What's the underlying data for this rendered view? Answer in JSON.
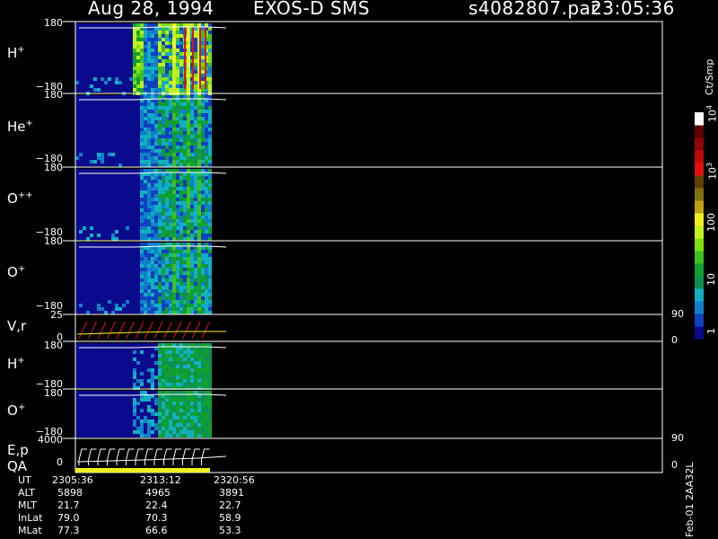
{
  "header": {
    "date": "Aug 28, 1994",
    "mission": "EXOS-D SMS",
    "file": "s4082807.par",
    "time": "23:05:36"
  },
  "colorbar": {
    "unit": "Ct/Smp",
    "ticks": [
      "1",
      "10",
      "100",
      "10",
      "10"
    ],
    "exps": [
      "3",
      "4"
    ],
    "colors": [
      "#0a0a8c",
      "#1040c0",
      "#1080c8",
      "#10b0c0",
      "#109050",
      "#10a030",
      "#40c020",
      "#80e010",
      "#c0f020",
      "#f0f020",
      "#c0a010",
      "#807010",
      "#604008",
      "#e01010",
      "#c00808",
      "#900404",
      "#600000",
      "#ffffff"
    ]
  },
  "panels": [
    {
      "label": "H",
      "sup": "+",
      "ytop": "180",
      "ybot": "−180"
    },
    {
      "label": "He",
      "sup": "+",
      "ytop": "180",
      "ybot": "−180"
    },
    {
      "label": "O",
      "sup": "++",
      "ytop": "180",
      "ybot": "−180"
    },
    {
      "label": "O",
      "sup": "+",
      "ytop": "180",
      "ybot": "−180"
    },
    {
      "label": "V,r",
      "sup": "",
      "ytop": "25",
      "ybot": "0",
      "rtop": "90",
      "rbot": "0"
    },
    {
      "label": "H",
      "sup": "+",
      "ytop": "180",
      "ybot": "−180"
    },
    {
      "label": "O",
      "sup": "+",
      "ytop": "180",
      "ybot": "−180"
    },
    {
      "label": "E,p",
      "sup": "",
      "ytop": "4000",
      "ybot": "0",
      "rtop": "90",
      "rbot": "0"
    }
  ],
  "qa_label": "QA",
  "footer": {
    "rows": [
      {
        "name": "UT",
        "vals": [
          "2305:36",
          "2313:12",
          "2320:56"
        ]
      },
      {
        "name": "ALT",
        "vals": [
          "5898",
          "4965",
          "3891"
        ]
      },
      {
        "name": "MLT",
        "vals": [
          "21.7",
          "22.4",
          "22.7"
        ]
      },
      {
        "name": "InLat",
        "vals": [
          "79.0",
          "70.3",
          "58.9"
        ]
      },
      {
        "name": "MLat",
        "vals": [
          "77.3",
          "66.6",
          "53.3"
        ]
      }
    ]
  },
  "side_note": "Feb-01  2AA32L",
  "chart_data": {
    "type": "heatmap",
    "x": [
      "2305:36",
      "2313:12",
      "2320:56"
    ],
    "series": [
      {
        "name": "H+",
        "ylim": [
          -180,
          180
        ]
      },
      {
        "name": "He+",
        "ylim": [
          -180,
          180
        ]
      },
      {
        "name": "O++",
        "ylim": [
          -180,
          180
        ]
      },
      {
        "name": "O+",
        "ylim": [
          -180,
          180
        ]
      },
      {
        "name": "V,r",
        "ylim": [
          0,
          25
        ],
        "y2lim": [
          0,
          90
        ]
      },
      {
        "name": "H+",
        "ylim": [
          -180,
          180
        ]
      },
      {
        "name": "O+",
        "ylim": [
          -180,
          180
        ]
      },
      {
        "name": "E,p",
        "ylim": [
          0,
          4000
        ],
        "y2lim": [
          0,
          90
        ]
      }
    ],
    "colorbar_label": "Ct/Smp",
    "colorbar_range": [
      1,
      10000
    ]
  }
}
